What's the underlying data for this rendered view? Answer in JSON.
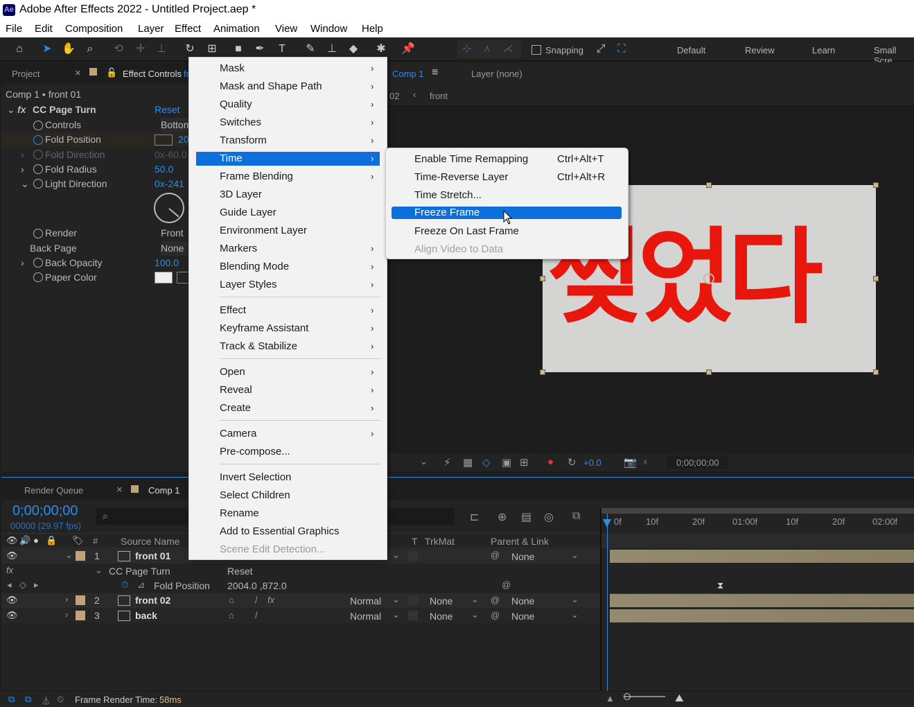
{
  "window": {
    "title": "Adobe After Effects 2022 - Untitled Project.aep *",
    "logo": "Ae"
  },
  "menubar": [
    "File",
    "Edit",
    "Composition",
    "Layer",
    "Effect",
    "Animation",
    "View",
    "Window",
    "Help"
  ],
  "toolbar": {
    "snapping": "Snapping",
    "workspaces": [
      "Default",
      "Review",
      "Learn",
      "Small Scre"
    ]
  },
  "left_panel": {
    "tabs": [
      "Project",
      "Effect Controls",
      "fr"
    ],
    "breadcrumb": "Comp 1 • front 01",
    "effect_name": "CC Page Turn",
    "reset": "Reset",
    "props": [
      {
        "label": "Controls",
        "value": "Bottom"
      },
      {
        "label": "Fold Position",
        "value": "20"
      },
      {
        "label": "Fold Direction",
        "value": "0x-60.0"
      },
      {
        "label": "Fold Radius",
        "value": "50.0"
      },
      {
        "label": "Light Direction",
        "value": "0x-241"
      },
      {
        "label": "Render",
        "value": "Front &"
      },
      {
        "label": "Back Page",
        "value": "None"
      },
      {
        "label": "Back Opacity",
        "value": "100.0"
      },
      {
        "label": "Paper Color",
        "value": ""
      }
    ]
  },
  "viewer": {
    "tabs": [
      "Comp 1",
      "Layer (none)"
    ],
    "breadcrumb": [
      "02",
      "front"
    ],
    "comp_text": "찢었다",
    "exposure": "+0.0",
    "timecode": "0;00;00;00"
  },
  "layer_menu": {
    "items": [
      {
        "label": "Mask",
        "arrow": true
      },
      {
        "label": "Mask and Shape Path",
        "arrow": true
      },
      {
        "label": "Quality",
        "arrow": true
      },
      {
        "label": "Switches",
        "arrow": true
      },
      {
        "label": "Transform",
        "arrow": true
      },
      {
        "label": "Time",
        "arrow": true,
        "selected": true
      },
      {
        "label": "Frame Blending",
        "arrow": true
      },
      {
        "label": "3D Layer",
        "arrow": false
      },
      {
        "label": "Guide Layer",
        "arrow": false
      },
      {
        "label": "Environment Layer",
        "arrow": false
      },
      {
        "label": "Markers",
        "arrow": true
      },
      {
        "label": "Blending Mode",
        "arrow": true
      },
      {
        "label": "Layer Styles",
        "arrow": true
      },
      {
        "label": "Effect",
        "arrow": true
      },
      {
        "label": "Keyframe Assistant",
        "arrow": true
      },
      {
        "label": "Track & Stabilize",
        "arrow": true
      },
      {
        "label": "Open",
        "arrow": true
      },
      {
        "label": "Reveal",
        "arrow": true
      },
      {
        "label": "Create",
        "arrow": true
      },
      {
        "label": "Camera",
        "arrow": true
      },
      {
        "label": "Pre-compose...",
        "arrow": false
      },
      {
        "label": "Invert Selection",
        "arrow": false
      },
      {
        "label": "Select Children",
        "arrow": false
      },
      {
        "label": "Rename",
        "arrow": false
      },
      {
        "label": "Add to Essential Graphics",
        "arrow": false
      },
      {
        "label": "Scene Edit Detection...",
        "arrow": false,
        "disabled": true
      }
    ]
  },
  "time_submenu": {
    "items": [
      {
        "label": "Enable Time Remapping",
        "shortcut": "Ctrl+Alt+T"
      },
      {
        "label": "Time-Reverse Layer",
        "shortcut": "Ctrl+Alt+R"
      },
      {
        "label": "Time Stretch...",
        "shortcut": ""
      },
      {
        "label": "Freeze Frame",
        "shortcut": "",
        "selected": true
      },
      {
        "label": "Freeze On Last Frame",
        "shortcut": ""
      },
      {
        "label": "Align Video to Data",
        "shortcut": "",
        "disabled": true
      }
    ]
  },
  "timeline": {
    "tabs": [
      "Render Queue",
      "Comp 1"
    ],
    "timecode": "0;00;00;00",
    "fps": "00000 (29.97 fps)",
    "columns": {
      "num": "#",
      "source": "Source Name",
      "t": "T",
      "trkmat": "TrkMat",
      "parent": "Parent & Link"
    },
    "ruler": [
      "0f",
      "10f",
      "20f",
      "01:00f",
      "10f",
      "20f",
      "02:00f"
    ],
    "layers": [
      {
        "num": "1",
        "name": "front 01",
        "mode": "",
        "trkmat": "",
        "parent": "None"
      },
      {
        "num": "2",
        "name": "front 02",
        "mode": "Normal",
        "trkmat": "None",
        "parent": "None"
      },
      {
        "num": "3",
        "name": "back",
        "mode": "Normal",
        "trkmat": "None",
        "parent": "None"
      }
    ],
    "effect_row": {
      "name": "CC Page Turn",
      "reset": "Reset"
    },
    "fold_row": {
      "name": "Fold Position",
      "value": "2004.0 ,872.0"
    }
  },
  "status": {
    "label": "Frame Render Time:",
    "value": "58ms"
  },
  "colors": {
    "menu_highlight": "#0d6fd9",
    "accent_blue": "#2d8ceb",
    "comp_text": "#e8170e",
    "layer_label": "#c3a27a"
  }
}
